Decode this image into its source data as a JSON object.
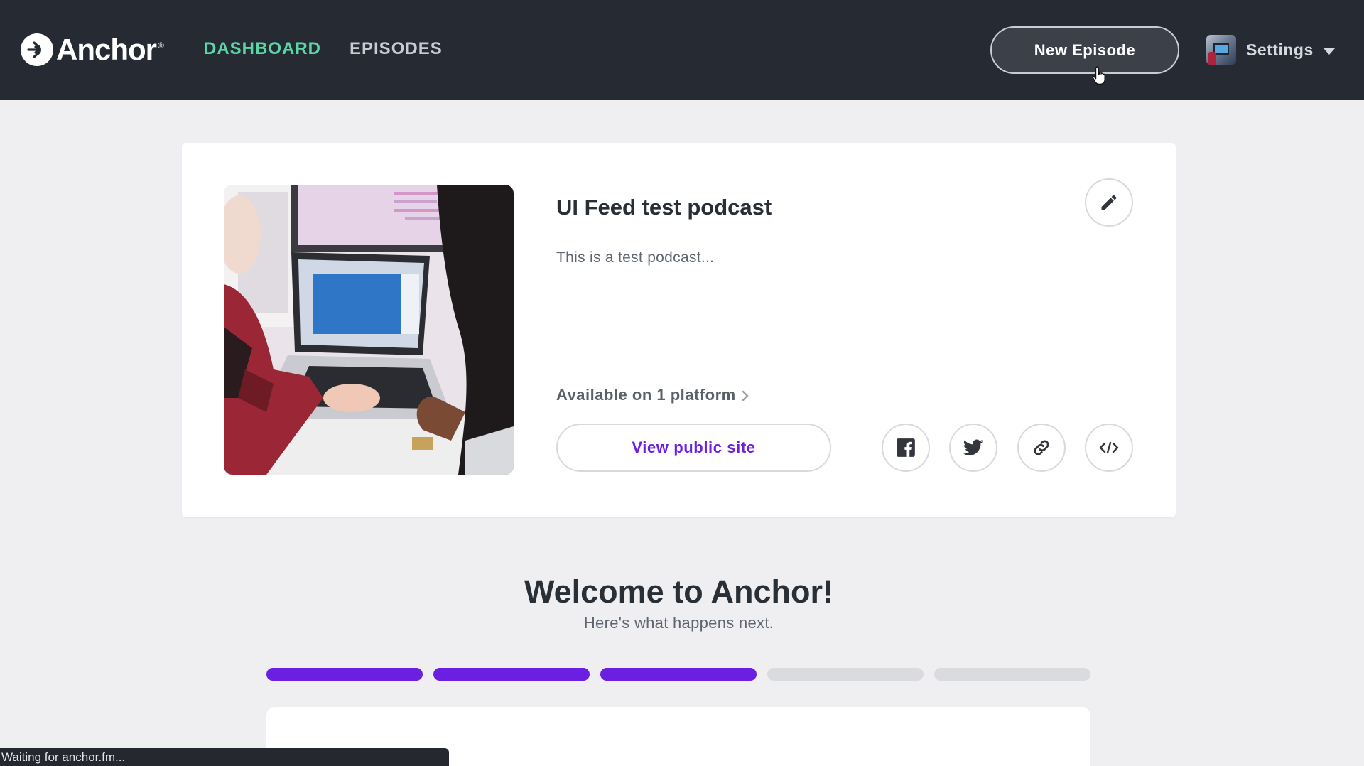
{
  "header": {
    "logo_text": "Anchor",
    "logo_reg": "®",
    "nav": [
      {
        "label": "DASHBOARD",
        "active": true
      },
      {
        "label": "EPISODES",
        "active": false
      }
    ],
    "new_episode_label": "New Episode",
    "settings_label": "Settings"
  },
  "podcast": {
    "title": "UI Feed test podcast",
    "description": "This is a test podcast...",
    "platforms_text": "Available on 1 platform",
    "view_public_label": "View public site",
    "share_icons": [
      "facebook-icon",
      "twitter-icon",
      "link-icon",
      "embed-code-icon"
    ]
  },
  "welcome": {
    "title": "Welcome to Anchor!",
    "subtitle": "Here's what happens next.",
    "progress": {
      "completed_steps": 3,
      "total_steps": 5
    }
  },
  "status_bar": {
    "text": "Waiting for anchor.fm..."
  },
  "colors": {
    "nav_background": "#252a33",
    "nav_active": "#5cd6a7",
    "accent_purple": "#6b1fe0",
    "page_background": "#efeff2"
  }
}
